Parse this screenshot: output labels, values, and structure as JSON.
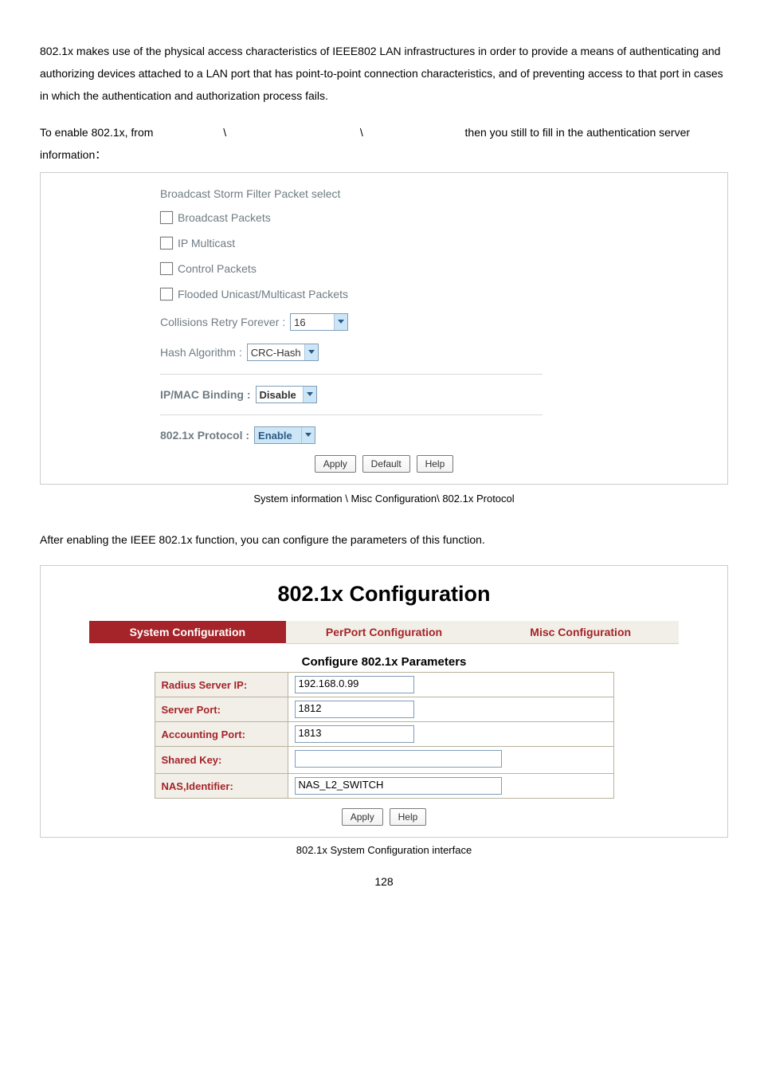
{
  "intro": {
    "p1": "802.1x makes use of the physical access characteristics of IEEE802 LAN infrastructures in order to provide a means of authenticating and authorizing devices attached to a LAN port that has point-to-point connection characteristics, and of preventing access to that port in cases in which the authentication and authorization process fails.",
    "p2a": "To enable 802.1x, from ",
    "p2b": "\\",
    "p2c": "\\",
    "p2d": "then you still to fill in the authentication server information："
  },
  "misc": {
    "storm_title": "Broadcast Storm Filter Packet select",
    "cb_broadcast": "Broadcast Packets",
    "cb_ipmulticast": "IP Multicast",
    "cb_control": "Control Packets",
    "cb_flooded": "Flooded Unicast/Multicast Packets",
    "collisions_label": "Collisions Retry Forever :",
    "collisions_value": "16",
    "hash_label": "Hash Algorithm :",
    "hash_value": "CRC-Hash",
    "ipmac_label": "IP/MAC Binding :",
    "ipmac_value": "Disable",
    "dot1x_label": "802.1x Protocol :",
    "dot1x_value": "Enable",
    "btn_apply": "Apply",
    "btn_default": "Default",
    "btn_help": "Help"
  },
  "caption1": "System information \\ Misc Configuration\\ 802.1x Protocol",
  "after_text": "After enabling the IEEE 802.1x function, you can configure the parameters of this function.",
  "cfg": {
    "title": "802.1x Configuration",
    "tabs": [
      "System Configuration",
      "PerPort Configuration",
      "Misc Configuration"
    ],
    "sub": "Configure 802.1x Parameters",
    "rows": [
      {
        "label": "Radius Server IP:",
        "value": "192.168.0.99"
      },
      {
        "label": "Server Port:",
        "value": "1812"
      },
      {
        "label": "Accounting Port:",
        "value": "1813"
      },
      {
        "label": "Shared Key:",
        "value": ""
      },
      {
        "label": "NAS,Identifier:",
        "value": "NAS_L2_SWITCH"
      }
    ],
    "btn_apply": "Apply",
    "btn_help": "Help"
  },
  "caption2": "802.1x System Configuration interface",
  "page_num": "128"
}
